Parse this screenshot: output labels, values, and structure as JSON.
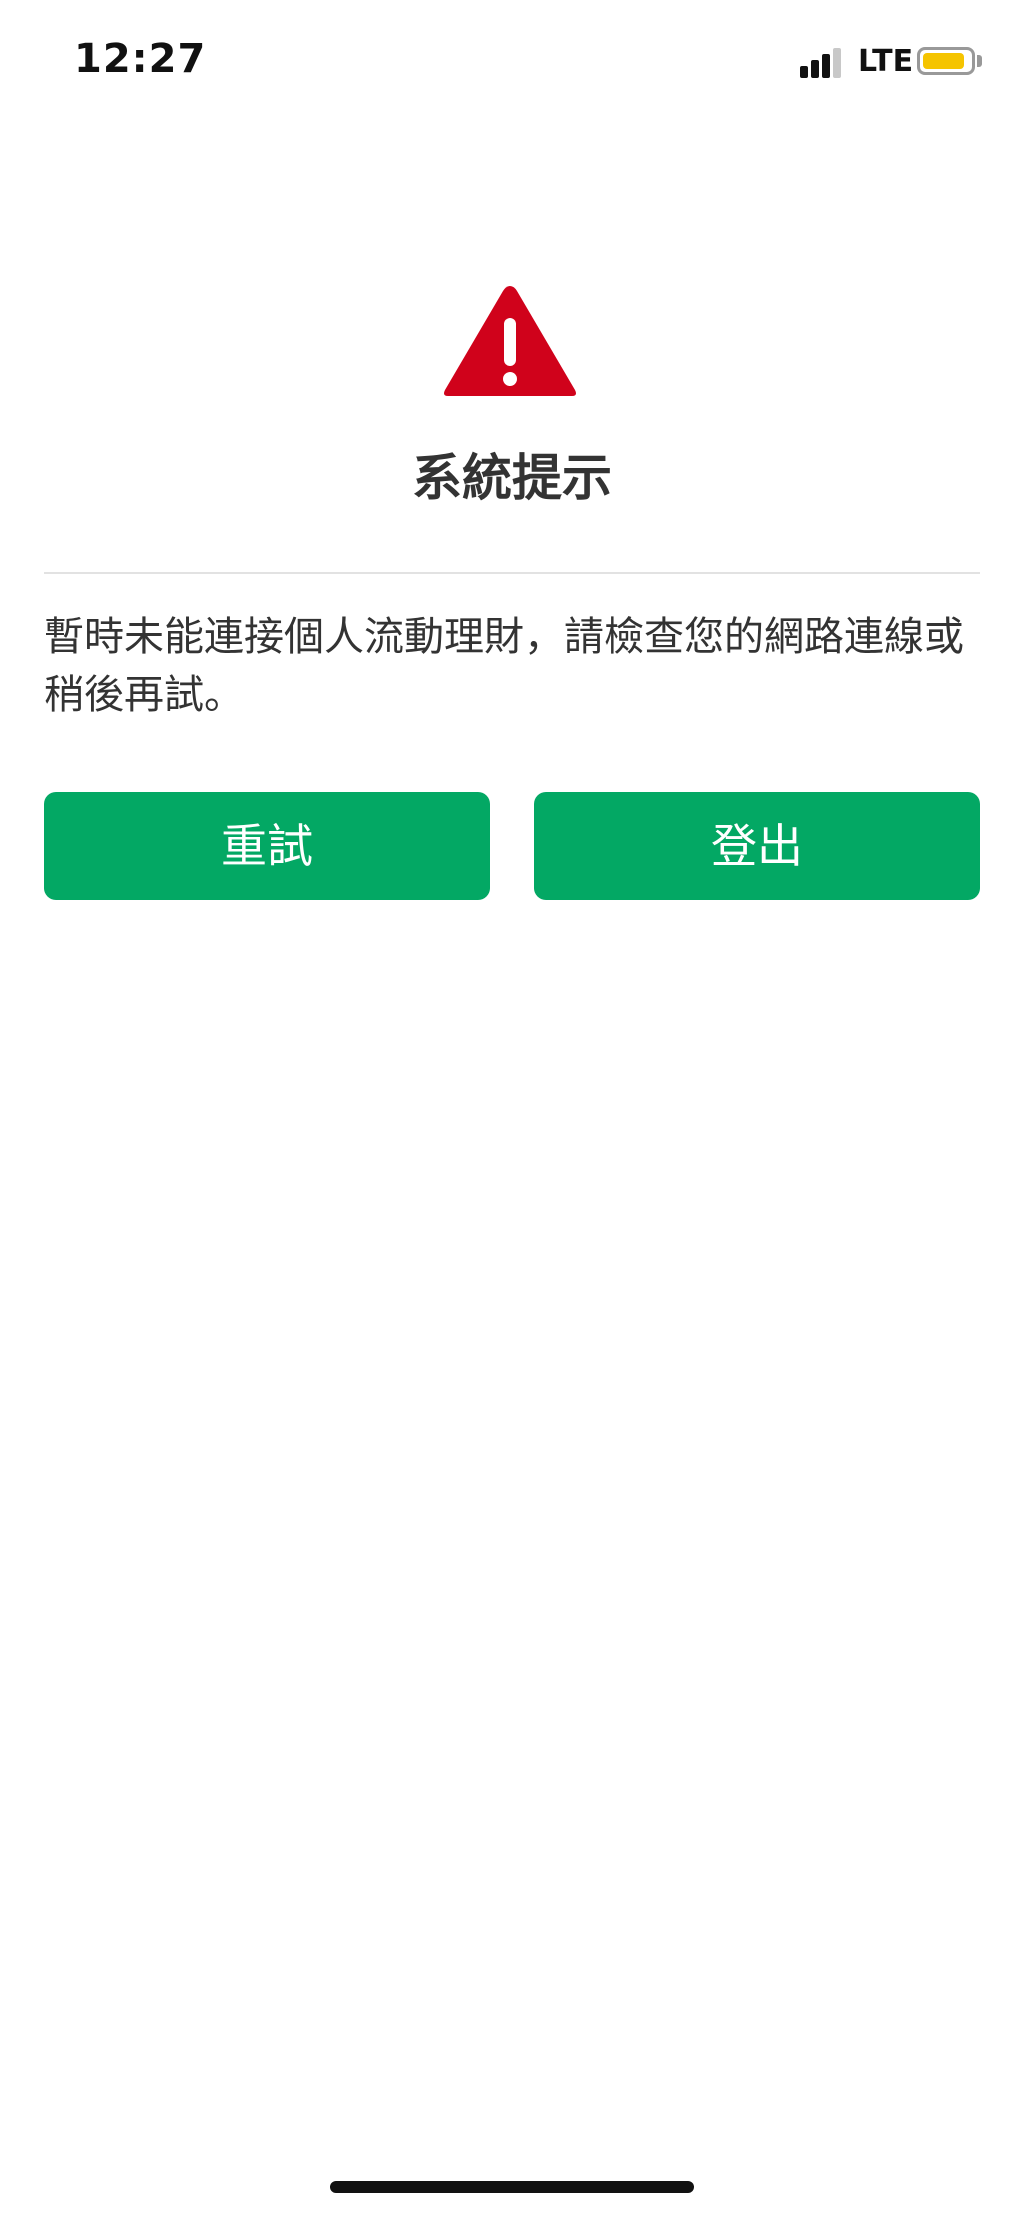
{
  "status_bar": {
    "time": "12:27",
    "network": "LTE",
    "signal_bars_filled": 3,
    "signal_bars_total": 4,
    "battery_color": "#f5c400",
    "battery_level": 0.9
  },
  "dialog": {
    "icon": "warning-triangle-icon",
    "icon_color": "#d0021b",
    "title": "系統提示",
    "message": "暫時未能連接個人流動理財，請檢查您的網路連線或稍後再試。",
    "buttons": {
      "retry_label": "重試",
      "logout_label": "登出"
    },
    "button_color": "#03a864"
  }
}
